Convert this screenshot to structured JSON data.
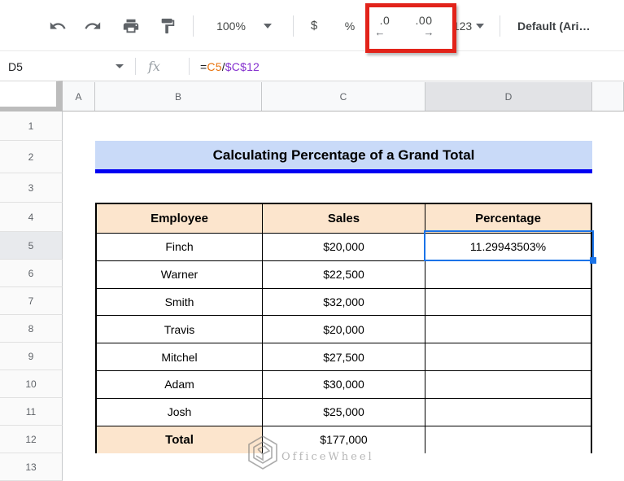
{
  "toolbar": {
    "icons": [
      "undo",
      "redo",
      "print",
      "paint-format"
    ],
    "zoom_value": "100%",
    "currency_label": "$",
    "percent_label": "%",
    "decrease_decimal_label": ".0",
    "decrease_decimal_arrow": "←",
    "increase_decimal_label": ".00",
    "increase_decimal_arrow": "→",
    "more_formats_label": "123",
    "font_name": "Default (Ari…",
    "annotation_box_color": "#e2231a"
  },
  "formula_bar": {
    "name_box_value": "D5",
    "fx_label": "fx",
    "formula": "=C5/$C$12",
    "formula_parts": [
      {
        "text": "=",
        "color": "#202124"
      },
      {
        "text": "C5",
        "color": "#e8710a"
      },
      {
        "text": "/",
        "color": "#202124"
      },
      {
        "text": "$C$12",
        "color": "#8430ce"
      }
    ]
  },
  "sheet": {
    "column_headers": [
      "A",
      "B",
      "C",
      "D"
    ],
    "row_headers": [
      "1",
      "2",
      "3",
      "4",
      "5",
      "6",
      "7",
      "8",
      "9",
      "10",
      "11",
      "12",
      "13"
    ],
    "selected_cell": "D5",
    "selected_column": "D",
    "selected_row": "5",
    "selection_color": "#1a73e8",
    "title": {
      "text": "Calculating Percentage of a Grand Total",
      "background": "#c9daf8",
      "underline_color": "#0000f2"
    },
    "table": {
      "header_background": "#fce5cd",
      "headers": [
        "Employee",
        "Sales",
        "Percentage"
      ],
      "rows": [
        {
          "employee": "Finch",
          "sales": "$20,000",
          "percentage": "11.29943503%"
        },
        {
          "employee": "Warner",
          "sales": "$22,500",
          "percentage": ""
        },
        {
          "employee": "Smith",
          "sales": "$32,000",
          "percentage": ""
        },
        {
          "employee": "Travis",
          "sales": "$20,000",
          "percentage": ""
        },
        {
          "employee": "Mitchel",
          "sales": "$27,500",
          "percentage": ""
        },
        {
          "employee": "Adam",
          "sales": "$30,000",
          "percentage": ""
        },
        {
          "employee": "Josh",
          "sales": "$25,000",
          "percentage": ""
        },
        {
          "employee": "Total",
          "sales": "$177,000",
          "percentage": "",
          "is_total": true
        }
      ]
    },
    "watermark": {
      "text": "OfficeWheel"
    }
  }
}
